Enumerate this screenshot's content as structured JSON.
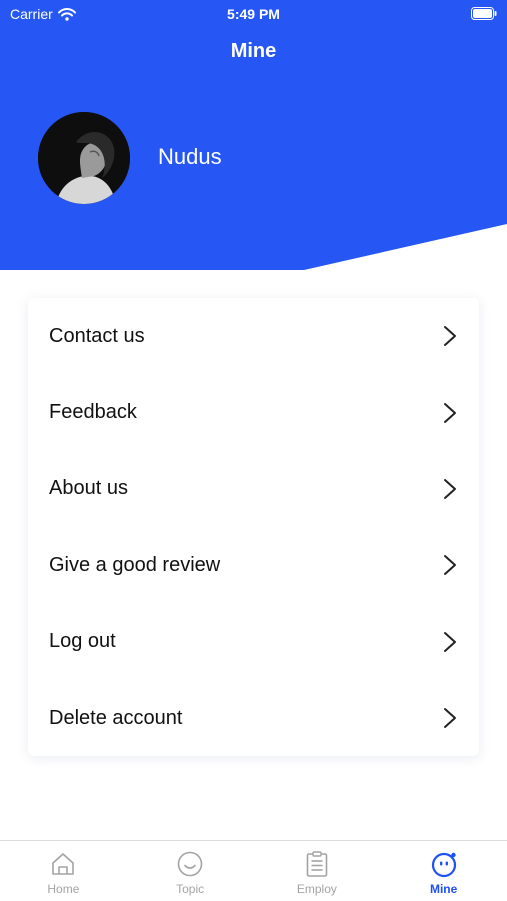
{
  "status_bar": {
    "carrier": "Carrier",
    "time": "5:49 PM"
  },
  "header": {
    "title": "Mine",
    "username": "Nudus",
    "bg_color": "#2657f5"
  },
  "menu": {
    "items": [
      {
        "label": "Contact us",
        "icon": "chevron-right-icon"
      },
      {
        "label": "Feedback",
        "icon": "chevron-right-icon"
      },
      {
        "label": "About us",
        "icon": "chevron-right-icon"
      },
      {
        "label": "Give a good review",
        "icon": "chevron-right-icon"
      },
      {
        "label": "Log out",
        "icon": "chevron-right-icon"
      },
      {
        "label": "Delete account",
        "icon": "chevron-right-icon"
      }
    ]
  },
  "tabbar": {
    "active_color": "#1f50f5",
    "inactive_color": "#a3a3a3",
    "tabs": [
      {
        "label": "Home",
        "icon": "home-icon",
        "active": false
      },
      {
        "label": "Topic",
        "icon": "smiley-icon",
        "active": false
      },
      {
        "label": "Employ",
        "icon": "clipboard-icon",
        "active": false
      },
      {
        "label": "Mine",
        "icon": "mine-face-icon",
        "active": true
      }
    ]
  }
}
